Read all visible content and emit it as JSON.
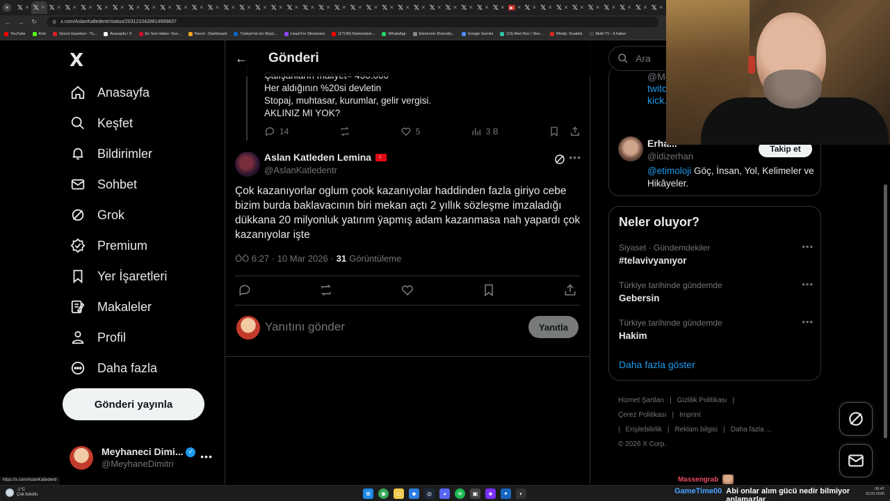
{
  "browser": {
    "url": "x.com/AslanKatledentr/status/2031210428814999837",
    "bookmarks": [
      {
        "label": "YouTube",
        "color": "#ff0000"
      },
      {
        "label": "Kick",
        "color": "#53fc18"
      },
      {
        "label": "Sözcü Gazetesi - Tü...",
        "color": "#e11d2a"
      },
      {
        "label": "Anasayfa / X",
        "color": "#ffffff"
      },
      {
        "label": "En Son Haber: Son...",
        "color": "#c8102e"
      },
      {
        "label": "Parrot - Dashboard",
        "color": "#f5a623"
      },
      {
        "label": "Türkiye'nin En Büyü...",
        "color": "#0a66c2"
      },
      {
        "label": "Livad For Streamers",
        "color": "#9146ff"
      },
      {
        "label": "(17145) Rammstein...",
        "color": "#ff0000"
      },
      {
        "label": "WhatsApp",
        "color": "#25d366"
      },
      {
        "label": "Electronic Diversity...",
        "color": "#888888"
      },
      {
        "label": "Google Gemini",
        "color": "#4f8cff"
      },
      {
        "label": "(19) Alert Box / Stre...",
        "color": "#31c3a2"
      },
      {
        "label": "Windy: Sıcaklık",
        "color": "#d52b1e"
      },
      {
        "label": "Multi TV - 6 haber",
        "color": "#444444"
      }
    ],
    "status_url": "https://x.com/AslanKatledentr"
  },
  "nav": {
    "logo": "X",
    "items": [
      {
        "label": "Anasayfa",
        "icon": "home-icon"
      },
      {
        "label": "Keşfet",
        "icon": "search-icon"
      },
      {
        "label": "Bildirimler",
        "icon": "bell-icon"
      },
      {
        "label": "Sohbet",
        "icon": "mail-icon"
      },
      {
        "label": "Grok",
        "icon": "grok-icon"
      },
      {
        "label": "Premium",
        "icon": "premium-icon"
      },
      {
        "label": "Yer İşaretleri",
        "icon": "bookmark-icon"
      },
      {
        "label": "Makaleler",
        "icon": "article-icon"
      },
      {
        "label": "Profil",
        "icon": "profile-icon"
      },
      {
        "label": "Daha fazla",
        "icon": "more-circle-icon"
      }
    ],
    "post_button": "Gönderi yayınla",
    "account": {
      "name": "Meyhaneci Dimi...",
      "handle": "@MeyhaneDimitri"
    }
  },
  "main": {
    "title": "Gönderi",
    "previous_post": {
      "lines": [
        "Çalışanların maliyet= 450.000",
        "Her aldığının %20si devletin",
        "Stopaj, muhtasar, kurumlar, gelir vergisi.",
        "AKLINIZ MI YOK?"
      ],
      "replies": "14",
      "likes": "5",
      "views": "3 B"
    },
    "tweet": {
      "name": "Aslan Katleden Lemina",
      "flag": "🇹🇷",
      "handle": "@AslanKatledentr",
      "text": "Çok kazanıyorlar oglum çook kazanıyolar haddinden fazla giriyo cebe bizim burda baklavacının biri mekan açtı 2 yıllık sözleşme imzaladığı dükkana 20 milyonluk yatırım ÿapmış adam kazanmasa nah yapardı çok kazanıyolar işte",
      "time": "ÖÖ 6:27 · 10 Mar 2026 ·",
      "views_count": "31",
      "views_label": "Görüntüleme"
    },
    "reply": {
      "placeholder": "Yanıtını gönder",
      "button": "Yanıtla"
    }
  },
  "right": {
    "search_placeholder": "Ara",
    "who_to_follow": {
      "prev_handle": "@Me...",
      "prev_links": [
        "twitc...",
        "kick..."
      ],
      "name": "Erha...",
      "handle": "@idizerhan",
      "follow": "Takip et",
      "bio_link": "@etimoloji",
      "bio_text": " Göç, İnsan, Yol, Kelimeler ve Hikâyeler."
    },
    "trends": {
      "title": "Neler oluyor?",
      "items": [
        {
          "context": "Siyaset · Gündemdekiler",
          "name": "#telavivyanıyor"
        },
        {
          "context": "Türkiye tarihinde gündemde",
          "name": "Gebersin"
        },
        {
          "context": "Türkiye tarihinde gündemde",
          "name": "Hakim"
        }
      ],
      "show_more": "Daha fazla göster"
    },
    "footer": [
      "Hizmet Şartları",
      "|",
      "Gizlilik Politikası",
      "|",
      "Çerez Politikası",
      "|",
      "Imprint",
      "|",
      "Erişilebilirlik",
      "|",
      "Reklam bilgisi",
      "|",
      "Daha fazla ...",
      "© 2026 X Corp."
    ]
  },
  "overlay": {
    "chat_user_1": "Massengrab",
    "chat_user_2": "GameTime00",
    "chat_msg_2": "Abi onlar alım gücü nedir bilmiyor anlamazlar"
  },
  "taskbar": {
    "weather_temp": "-1°C",
    "weather_text": "Çok bulutlu",
    "clock_time": "06:47",
    "clock_date": "10.03.2026"
  }
}
